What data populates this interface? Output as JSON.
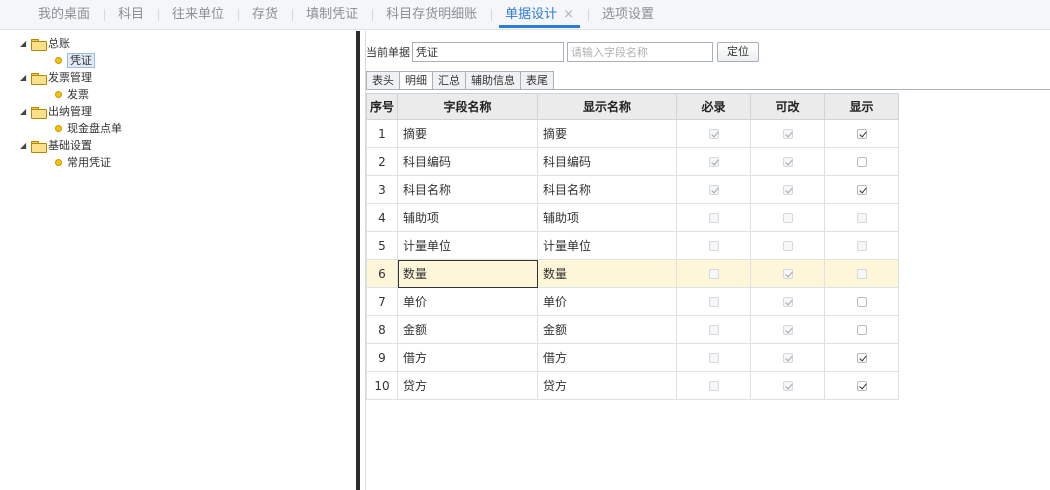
{
  "nav": {
    "items": [
      {
        "label": "我的桌面",
        "active": false
      },
      {
        "label": "科目",
        "active": false
      },
      {
        "label": "往来单位",
        "active": false
      },
      {
        "label": "存货",
        "active": false
      },
      {
        "label": "填制凭证",
        "active": false
      },
      {
        "label": "科目存货明细账",
        "active": false
      },
      {
        "label": "单据设计",
        "active": true,
        "closable": true
      },
      {
        "label": "选项设置",
        "active": false
      }
    ],
    "close_glyph": "×",
    "accent_color": "#2f7cd6"
  },
  "tree": {
    "nodes": [
      {
        "label": "总账",
        "children": [
          {
            "label": "凭证",
            "selected": true
          }
        ]
      },
      {
        "label": "发票管理",
        "children": [
          {
            "label": "发票"
          }
        ]
      },
      {
        "label": "出纳管理",
        "children": [
          {
            "label": "现金盘点单"
          }
        ]
      },
      {
        "label": "基础设置",
        "children": [
          {
            "label": "常用凭证"
          }
        ]
      }
    ]
  },
  "toolbar": {
    "current_doc_label": "当前单据",
    "current_doc_value": "凭证",
    "search_placeholder": "请输入字段名称",
    "locate_button": "定位"
  },
  "tabs": [
    {
      "label": "表头",
      "active": false
    },
    {
      "label": "明细",
      "active": true
    },
    {
      "label": "汇总",
      "active": false
    },
    {
      "label": "辅助信息",
      "active": false
    },
    {
      "label": "表尾",
      "active": false
    }
  ],
  "grid": {
    "columns": [
      "序号",
      "字段名称",
      "显示名称",
      "必录",
      "可改",
      "显示"
    ],
    "rows": [
      {
        "no": "1",
        "field": "摘要",
        "display": "摘要",
        "required": {
          "checked": true,
          "enabled": false
        },
        "editable": {
          "checked": true,
          "enabled": false
        },
        "visible": {
          "checked": true,
          "enabled": true
        }
      },
      {
        "no": "2",
        "field": "科目编码",
        "display": "科目编码",
        "required": {
          "checked": true,
          "enabled": false
        },
        "editable": {
          "checked": true,
          "enabled": false
        },
        "visible": {
          "checked": false,
          "enabled": true
        }
      },
      {
        "no": "3",
        "field": "科目名称",
        "display": "科目名称",
        "required": {
          "checked": true,
          "enabled": false
        },
        "editable": {
          "checked": true,
          "enabled": false
        },
        "visible": {
          "checked": true,
          "enabled": true
        }
      },
      {
        "no": "4",
        "field": "辅助项",
        "display": "辅助项",
        "required": {
          "checked": false,
          "enabled": false
        },
        "editable": {
          "checked": false,
          "enabled": false
        },
        "visible": {
          "checked": false,
          "enabled": false
        }
      },
      {
        "no": "5",
        "field": "计量单位",
        "display": "计量单位",
        "required": {
          "checked": false,
          "enabled": false
        },
        "editable": {
          "checked": false,
          "enabled": false
        },
        "visible": {
          "checked": false,
          "enabled": false
        }
      },
      {
        "no": "6",
        "field": "数量",
        "display": "数量",
        "highlight": true,
        "editing": true,
        "required": {
          "checked": false,
          "enabled": false
        },
        "editable": {
          "checked": true,
          "enabled": false
        },
        "visible": {
          "checked": false,
          "enabled": false
        }
      },
      {
        "no": "7",
        "field": "单价",
        "display": "单价",
        "required": {
          "checked": false,
          "enabled": false
        },
        "editable": {
          "checked": true,
          "enabled": false
        },
        "visible": {
          "checked": false,
          "enabled": true
        }
      },
      {
        "no": "8",
        "field": "金额",
        "display": "金额",
        "required": {
          "checked": false,
          "enabled": false
        },
        "editable": {
          "checked": true,
          "enabled": false
        },
        "visible": {
          "checked": false,
          "enabled": true
        }
      },
      {
        "no": "9",
        "field": "借方",
        "display": "借方",
        "required": {
          "checked": false,
          "enabled": false
        },
        "editable": {
          "checked": true,
          "enabled": false
        },
        "visible": {
          "checked": true,
          "enabled": true
        }
      },
      {
        "no": "10",
        "field": "贷方",
        "display": "贷方",
        "required": {
          "checked": false,
          "enabled": false
        },
        "editable": {
          "checked": true,
          "enabled": false
        },
        "visible": {
          "checked": true,
          "enabled": true
        }
      }
    ]
  }
}
